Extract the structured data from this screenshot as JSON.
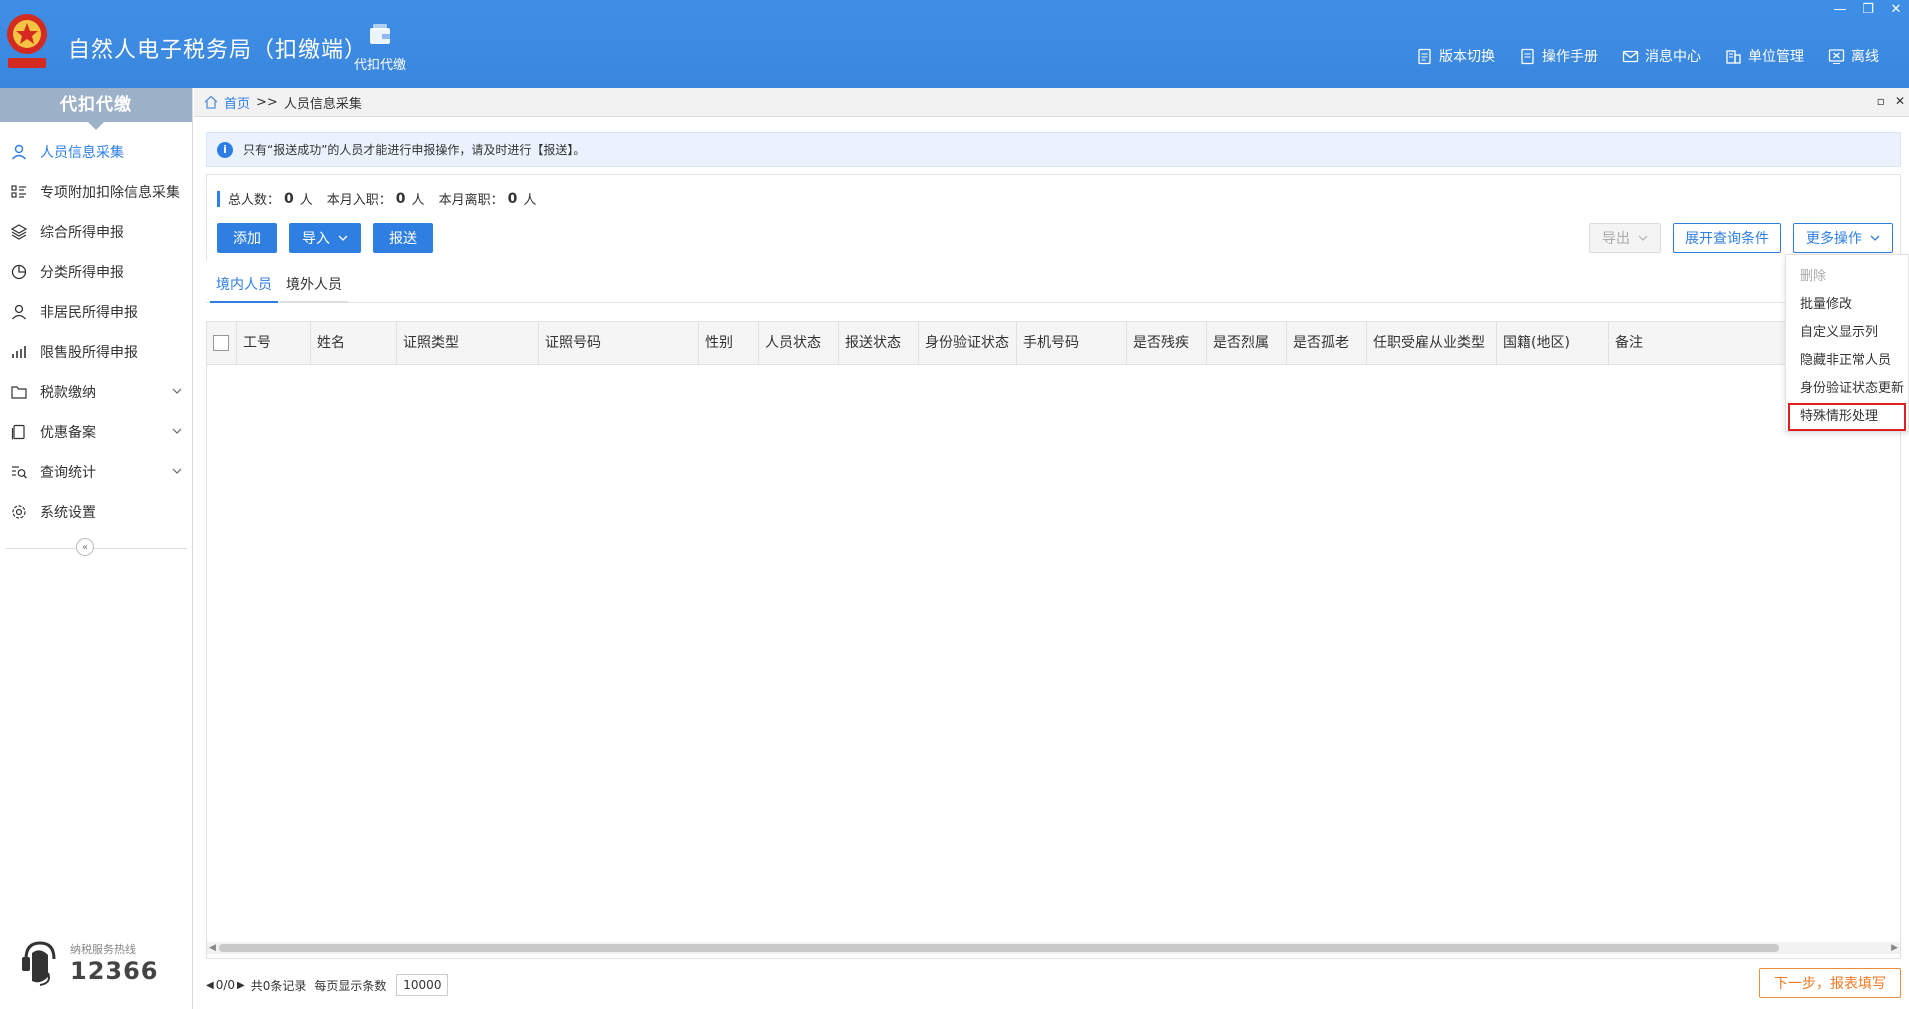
{
  "header": {
    "title": "自然人电子税务局（扣缴端）",
    "module": "代扣代缴",
    "nav": [
      {
        "label": "版本切换",
        "icon": "document-icon"
      },
      {
        "label": "操作手册",
        "icon": "manual-icon"
      },
      {
        "label": "消息中心",
        "icon": "mail-icon"
      },
      {
        "label": "单位管理",
        "icon": "building-icon"
      },
      {
        "label": "离线",
        "icon": "offline-icon"
      }
    ]
  },
  "sidebar": {
    "title": "代扣代缴",
    "items": [
      {
        "label": "人员信息采集",
        "icon": "person-icon",
        "active": true
      },
      {
        "label": "专项附加扣除信息采集",
        "icon": "list-icon"
      },
      {
        "label": "综合所得申报",
        "icon": "layers-icon"
      },
      {
        "label": "分类所得申报",
        "icon": "pie-icon"
      },
      {
        "label": "非居民所得申报",
        "icon": "person-icon"
      },
      {
        "label": "限售股所得申报",
        "icon": "bar-chart-icon"
      },
      {
        "label": "税款缴纳",
        "icon": "folder-icon",
        "expandable": true
      },
      {
        "label": "优惠备案",
        "icon": "copy-icon",
        "expandable": true
      },
      {
        "label": "查询统计",
        "icon": "search-list-icon",
        "expandable": true
      },
      {
        "label": "系统设置",
        "icon": "gear-icon"
      }
    ],
    "hotline_label": "纳税服务热线",
    "hotline_number": "12366"
  },
  "breadcrumb": {
    "home": "首页",
    "sep": ">>",
    "current": "人员信息采集"
  },
  "notice": "只有“报送成功”的人员才能进行申报操作，请及时进行【报送】。",
  "stats": {
    "total_label": "总人数：",
    "total": "0",
    "total_unit": "人",
    "join_label": "本月入职：",
    "join": "0",
    "join_unit": "人",
    "leave_label": "本月离职：",
    "leave": "0",
    "leave_unit": "人"
  },
  "toolbar": {
    "add": "添加",
    "import": "导入",
    "submit": "报送",
    "export": "导出",
    "expand_query": "展开查询条件",
    "more": "更多操作"
  },
  "tabs": [
    "境内人员",
    "境外人员"
  ],
  "table": {
    "columns": [
      "工号",
      "姓名",
      "证照类型",
      "证照号码",
      "性别",
      "人员状态",
      "报送状态",
      "身份验证状态",
      "手机号码",
      "是否残疾",
      "是否烈属",
      "是否孤老",
      "任职受雇从业类型",
      "国籍(地区)",
      "备注"
    ]
  },
  "pager": {
    "page": "0/0",
    "total": "共0条记录",
    "per_page_label": "每页显示条数",
    "per_page": "10000"
  },
  "next_button": "下一步，报表填写",
  "more_menu": [
    "删除",
    "批量修改",
    "自定义显示列",
    "隐藏非正常人员",
    "身份验证状态更新",
    "特殊情形处理"
  ]
}
